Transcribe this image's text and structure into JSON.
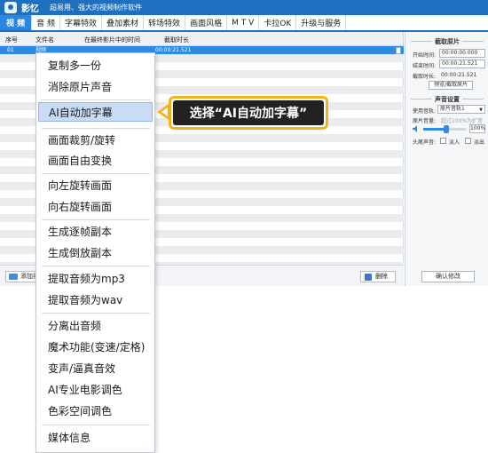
{
  "app": {
    "name": "影忆",
    "slogan": "超易用、强大的视频制作软件"
  },
  "tabs": [
    {
      "label": "视  频"
    },
    {
      "label": "音  频"
    },
    {
      "label": "字幕特效"
    },
    {
      "label": "叠加素材"
    },
    {
      "label": "转场特效"
    },
    {
      "label": "画面风格"
    },
    {
      "label": "M T V"
    },
    {
      "label": "卡拉OK"
    },
    {
      "label": "升级与服务"
    }
  ],
  "table": {
    "columns": [
      "序号",
      "文件名",
      "在最终影片中的时间",
      "截取时长"
    ],
    "selected_row": {
      "index": "01",
      "name": "视频",
      "duration": "00:00:21.521"
    }
  },
  "bottom": {
    "add_label": "添加视",
    "delete_label": "删除"
  },
  "clip_panel": {
    "title": "截取原片",
    "start_label": "开始时间:",
    "start_value": "00:00:00.000",
    "end_label": "结束时间:",
    "end_value": "00:00:21.521",
    "length_label": "截取时长:",
    "length_value": "00:00:21.521",
    "preview_button": "预览/截取原片"
  },
  "audio_panel": {
    "title": "声音设置",
    "track_label": "使用音轨:",
    "track_value": "原片音轨1",
    "volume_label": "原片音量:",
    "volume_hint": "超过100%为扩音",
    "volume_pct": "100%",
    "volume_level": 0.55,
    "fade_label": "头尾声音:",
    "fade_in": "淡入",
    "fade_out": "淡出"
  },
  "confirm_button": "确认修改",
  "context_menu": {
    "items": [
      "复制多一份",
      "消除原片声音",
      "AI自动加字幕",
      "画面裁剪/旋转",
      "画面自由变换",
      "向左旋转画面",
      "向右旋转画面",
      "生成逐帧副本",
      "生成倒放副本",
      "提取音频为mp3",
      "提取音频为wav",
      "分离出音频",
      "魔术功能(变速/定格)",
      "变声/逼真音效",
      "AI专业电影调色",
      "色彩空间调色",
      "媒体信息"
    ]
  },
  "callout": {
    "text": "选择“AI自动加字幕”"
  },
  "colors": {
    "accent": "#1d6fbf",
    "selection": "#2f8ae6",
    "callout_border": "#f5b21b",
    "callout_bg": "#222222"
  }
}
